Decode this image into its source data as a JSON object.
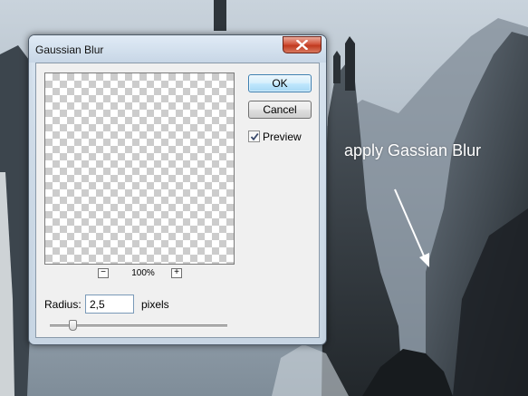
{
  "annotation": {
    "text": "apply Gassian Blur"
  },
  "dialog": {
    "title": "Gaussian Blur",
    "close_icon": "close-icon",
    "ok_label": "OK",
    "cancel_label": "Cancel",
    "preview_label": "Preview",
    "preview_checked": true,
    "zoom_out_label": "−",
    "zoom_in_label": "+",
    "zoom_level": "100%",
    "radius_label": "Radius:",
    "radius_value": "2,5",
    "radius_unit": "pixels",
    "radius_slider_fraction": 0.13
  },
  "colors": {
    "ok_border": "#3c7fb1",
    "close_button": "#c03a1f",
    "annotation": "#ffffff"
  }
}
